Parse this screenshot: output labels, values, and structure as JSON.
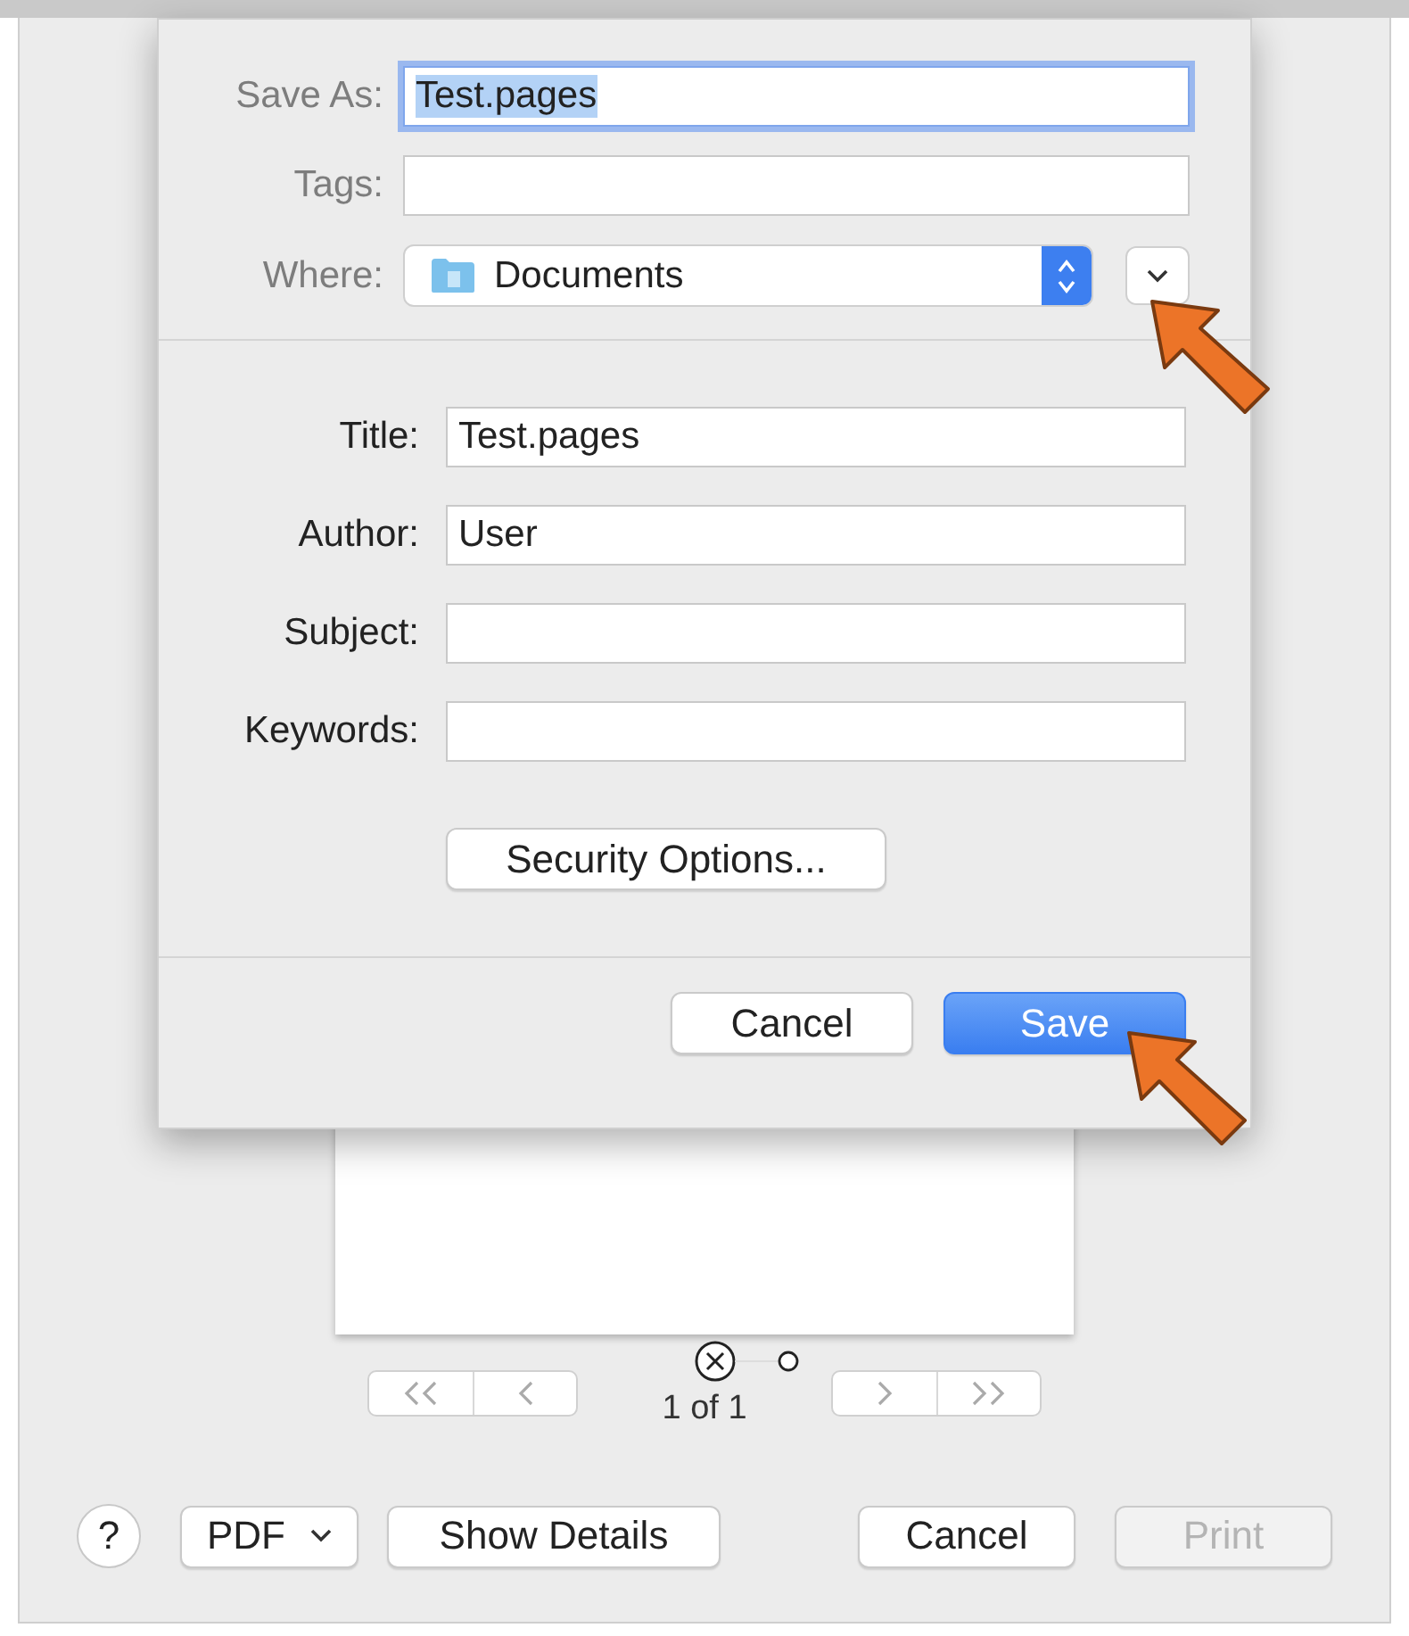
{
  "save_sheet": {
    "save_as": {
      "label": "Save As:",
      "value": "Test.pages",
      "selected": true
    },
    "tags": {
      "label": "Tags:"
    },
    "where": {
      "label": "Where:",
      "value": "Documents"
    },
    "metadata": [
      {
        "label": "Title:",
        "value": "Test.pages"
      },
      {
        "label": "Author:",
        "value": "User"
      },
      {
        "label": "Subject:"
      },
      {
        "label": "Keywords:"
      }
    ],
    "security_button": "Security Options...",
    "buttons": [
      {
        "label": "Cancel",
        "kind": "secondary"
      },
      {
        "label": "Save",
        "kind": "default"
      }
    ]
  },
  "preview": {
    "page_indicator": "1 of 1"
  },
  "print_dialog": {
    "help": "?",
    "format": "PDF",
    "show_details": "Show Details",
    "cancel": "Cancel",
    "print": {
      "label": "Print",
      "disabled": true
    }
  }
}
